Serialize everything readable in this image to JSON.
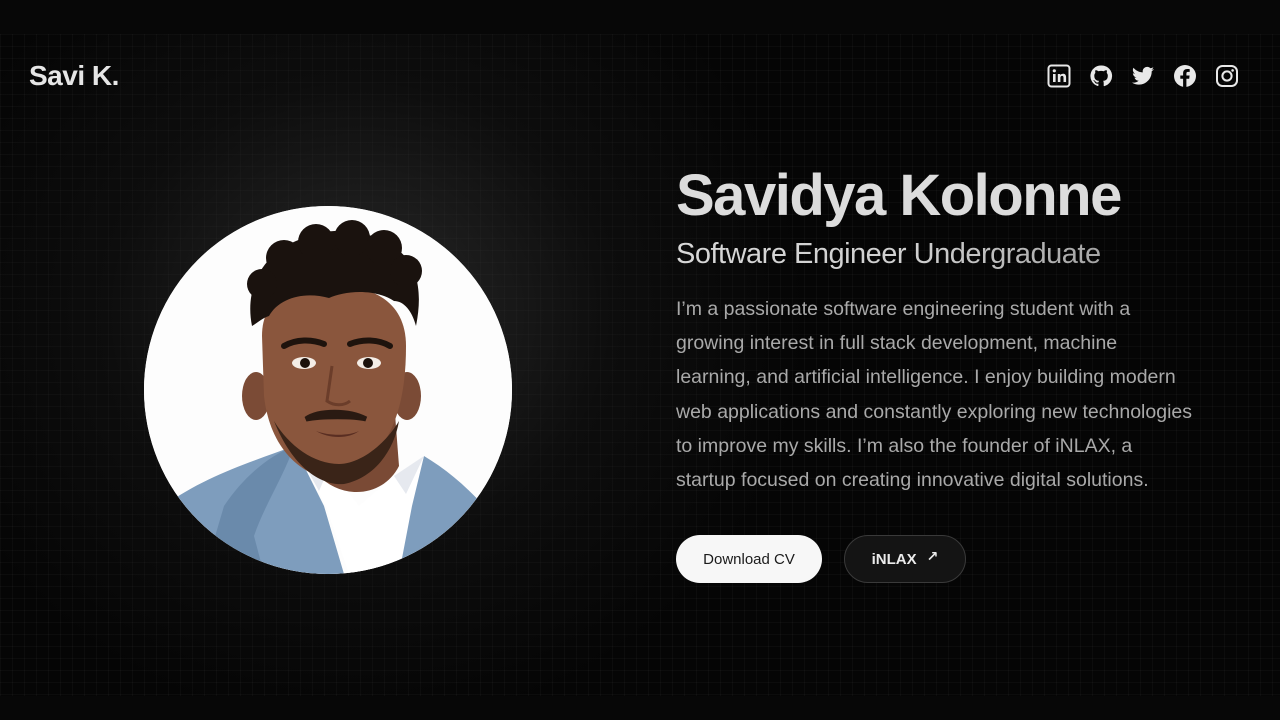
{
  "header": {
    "logo": "Savi K.",
    "socials": [
      {
        "icon": "linkedin-icon",
        "label": "LinkedIn"
      },
      {
        "icon": "github-icon",
        "label": "GitHub"
      },
      {
        "icon": "twitter-icon",
        "label": "Twitter"
      },
      {
        "icon": "facebook-icon",
        "label": "Facebook"
      },
      {
        "icon": "instagram-icon",
        "label": "Instagram"
      }
    ]
  },
  "hero": {
    "name": "Savidya Kolonne",
    "role": "Software Engineer Undergraduate",
    "bio": "I’m a passionate software engineering student with a growing interest in full stack development, machine learning, and artificial intelligence. I enjoy building modern web applications and constantly exploring new technologies to improve my skills. I’m also the founder of iNLAX, a startup focused on creating innovative digital solutions.",
    "buttons": {
      "download_cv": "Download CV",
      "inlax": "iNLAX",
      "inlax_arrow": "↗"
    }
  },
  "colors": {
    "background": "#050505",
    "text_primary": "#dcdcdc",
    "text_secondary": "#a9a9a9",
    "button_primary_bg": "#f7f7f7",
    "button_secondary_bg": "#141414"
  }
}
